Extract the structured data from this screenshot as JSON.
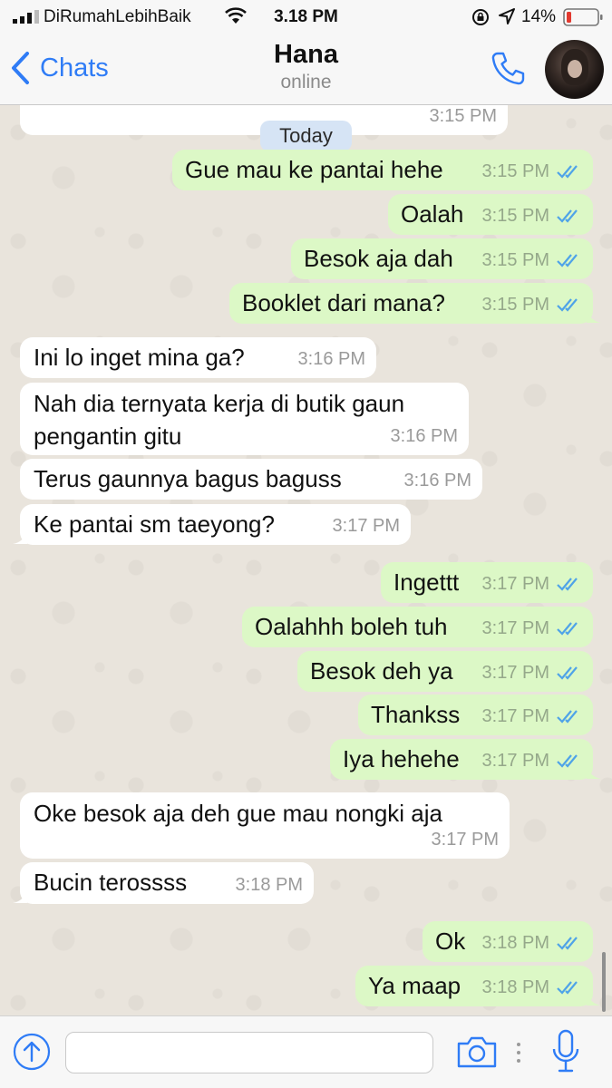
{
  "status_bar": {
    "carrier": "DiRumahLebihBaik",
    "time": "3.18 PM",
    "battery": "14%",
    "icons": [
      "signal-icon",
      "wifi-icon",
      "orientation-lock-icon",
      "location-icon",
      "battery-icon"
    ]
  },
  "header": {
    "back_label": "Chats",
    "contact_name": "Hana",
    "contact_status": "online",
    "icons": [
      "chevron-left-icon",
      "phone-icon",
      "avatar"
    ]
  },
  "chat": {
    "date_separator": "Today",
    "top_partial_time": "3:15 PM",
    "messages": [
      {
        "dir": "out",
        "text": "Gue mau ke pantai hehe",
        "time": "3:15 PM"
      },
      {
        "dir": "out",
        "text": "Oalah",
        "time": "3:15 PM"
      },
      {
        "dir": "out",
        "text": "Besok aja dah",
        "time": "3:15 PM"
      },
      {
        "dir": "out",
        "text": "Booklet dari mana?",
        "time": "3:15 PM"
      },
      {
        "dir": "in",
        "text": "Ini lo inget mina ga?",
        "time": "3:16 PM"
      },
      {
        "dir": "in",
        "text": "Nah dia ternyata kerja di butik gaun",
        "text2": "pengantin gitu",
        "time": "3:16 PM"
      },
      {
        "dir": "in",
        "text": "Terus gaunnya bagus baguss",
        "time": "3:16 PM"
      },
      {
        "dir": "in",
        "text": "Ke pantai sm taeyong?",
        "time": "3:17 PM"
      },
      {
        "dir": "out",
        "text": "Ingettt",
        "time": "3:17 PM"
      },
      {
        "dir": "out",
        "text": "Oalahhh boleh tuh",
        "time": "3:17 PM"
      },
      {
        "dir": "out",
        "text": "Besok deh ya",
        "time": "3:17 PM"
      },
      {
        "dir": "out",
        "text": "Thankss",
        "time": "3:17 PM"
      },
      {
        "dir": "out",
        "text": "Iya hehehe",
        "time": "3:17 PM"
      },
      {
        "dir": "in",
        "text": "Oke besok aja deh gue mau nongki aja",
        "time": "3:17 PM"
      },
      {
        "dir": "in",
        "text": "Bucin terossss",
        "time": "3:18 PM"
      },
      {
        "dir": "out",
        "text": "Ok",
        "time": "3:18 PM"
      },
      {
        "dir": "out",
        "text": "Ya maap",
        "time": "3:18 PM"
      }
    ]
  },
  "input_bar": {
    "placeholder": "",
    "icons": [
      "arrow-up-icon",
      "camera-icon",
      "more-dots-icon",
      "microphone-icon"
    ]
  },
  "colors": {
    "accent": "#2f7cf6",
    "outgoing_bubble": "#dcf8c6",
    "incoming_bubble": "#ffffff",
    "read_ticks": "#4fa3e8",
    "date_pill": "#d6e4f5"
  }
}
